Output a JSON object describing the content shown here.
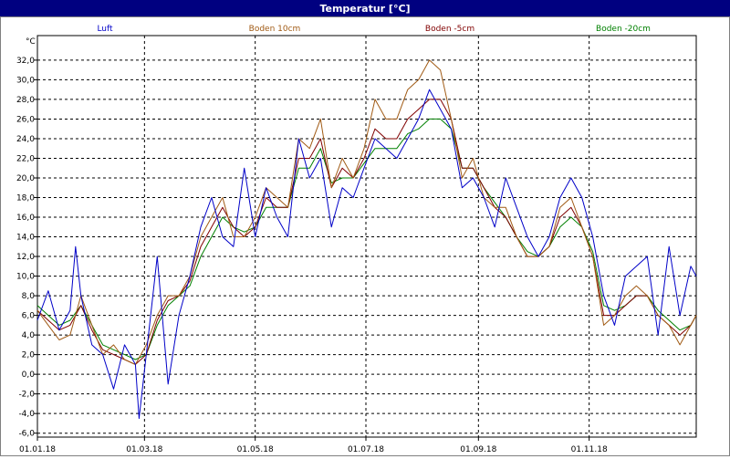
{
  "window": {
    "title": "Temperatur [°C]"
  },
  "colors": {
    "title_bar": "#000080",
    "grid": "#000000",
    "series": {
      "Luft": "#0000c8",
      "Boden 10cm": "#a05a14",
      "Boden -5cm": "#800000",
      "Boden -20cm": "#008000"
    }
  },
  "chart_data": {
    "type": "line",
    "title": "Temperatur [°C]",
    "ylabel": "°C",
    "xlabel": "",
    "x_tick_labels": [
      "01.01.18",
      "01.03.18",
      "01.05.18",
      "01.07.18",
      "01.09.18",
      "01.11.18"
    ],
    "y_tick_labels": [
      "-6,0",
      "-4,0",
      "-2,0",
      "0,0",
      "2,0",
      "4,0",
      "6,0",
      "8,0",
      "10,0",
      "12,0",
      "14,0",
      "16,0",
      "18,0",
      "20,0",
      "22,0",
      "24,0",
      "26,0",
      "28,0",
      "30,0",
      "32,0"
    ],
    "ylim": [
      -6.4,
      34.5
    ],
    "x_range_days": [
      0,
      363
    ],
    "x_tick_days": [
      0,
      59,
      120,
      181,
      243,
      304
    ],
    "grid": true,
    "legend_position": "top",
    "series": [
      {
        "name": "Luft",
        "x": [
          0,
          6,
          12,
          18,
          21,
          24,
          30,
          36,
          42,
          48,
          54,
          56,
          60,
          66,
          72,
          78,
          84,
          90,
          96,
          102,
          108,
          114,
          120,
          126,
          132,
          138,
          144,
          150,
          156,
          162,
          168,
          174,
          180,
          186,
          192,
          198,
          204,
          210,
          216,
          222,
          228,
          234,
          240,
          246,
          252,
          258,
          264,
          270,
          276,
          282,
          288,
          294,
          300,
          306,
          312,
          318,
          324,
          330,
          336,
          342,
          348,
          354,
          360,
          363
        ],
        "y": [
          5.5,
          8.5,
          4.5,
          6.5,
          13,
          8,
          3,
          2,
          -1.5,
          3,
          1,
          -4.5,
          2,
          12,
          -1,
          6,
          10,
          15,
          18,
          14,
          13,
          21,
          14,
          19,
          16,
          14,
          24,
          20,
          22,
          15,
          19,
          18,
          21,
          24,
          23,
          22,
          24,
          26,
          29,
          27,
          25,
          19,
          20,
          18,
          15,
          20,
          17,
          14,
          12,
          14,
          18,
          20,
          18,
          14,
          8,
          5,
          10,
          11,
          12,
          4,
          13,
          6,
          11,
          10
        ]
      },
      {
        "name": "Boden 10cm",
        "x": [
          0,
          6,
          12,
          18,
          24,
          30,
          36,
          42,
          48,
          54,
          60,
          66,
          72,
          78,
          84,
          90,
          96,
          102,
          108,
          114,
          120,
          126,
          132,
          138,
          144,
          150,
          156,
          162,
          168,
          174,
          180,
          186,
          192,
          198,
          204,
          210,
          216,
          222,
          228,
          234,
          240,
          246,
          252,
          258,
          264,
          270,
          276,
          282,
          288,
          294,
          300,
          306,
          312,
          318,
          324,
          330,
          336,
          342,
          348,
          354,
          360,
          363
        ],
        "y": [
          6.5,
          5,
          3.5,
          4,
          8,
          5,
          2,
          3,
          1.5,
          1,
          3,
          6,
          8,
          8,
          10,
          14,
          16,
          18,
          14,
          14,
          16,
          19,
          18,
          17,
          24,
          23,
          26,
          19,
          22,
          20,
          23,
          28,
          26,
          26,
          29,
          30,
          32,
          31,
          26,
          20,
          22,
          18,
          17,
          17,
          14,
          12,
          12,
          13,
          17,
          18,
          15,
          12,
          5,
          6,
          8,
          9,
          8,
          6,
          5,
          3,
          5,
          6
        ]
      },
      {
        "name": "Boden -5cm",
        "x": [
          0,
          6,
          12,
          18,
          24,
          30,
          36,
          42,
          48,
          54,
          60,
          66,
          72,
          78,
          84,
          90,
          96,
          102,
          108,
          114,
          120,
          126,
          132,
          138,
          144,
          150,
          156,
          162,
          168,
          174,
          180,
          186,
          192,
          198,
          204,
          210,
          216,
          222,
          228,
          234,
          240,
          246,
          252,
          258,
          264,
          270,
          276,
          282,
          288,
          294,
          300,
          306,
          312,
          318,
          324,
          330,
          336,
          342,
          348,
          354,
          360,
          363
        ],
        "y": [
          6.5,
          5.5,
          4.5,
          5,
          7,
          4.5,
          2.5,
          2,
          1.5,
          1,
          2,
          5.5,
          7.5,
          8,
          9.5,
          13,
          15,
          17,
          15,
          14,
          15,
          18,
          17,
          17,
          22,
          22,
          24,
          19,
          21,
          20,
          22,
          25,
          24,
          24,
          26,
          27,
          28,
          28,
          26,
          21,
          21,
          19,
          17,
          16,
          14,
          12,
          12,
          13,
          16,
          17,
          15,
          12,
          6,
          6,
          7,
          8,
          8,
          6,
          5,
          4,
          5,
          6
        ]
      },
      {
        "name": "Boden -20cm",
        "x": [
          0,
          6,
          12,
          18,
          24,
          30,
          36,
          42,
          48,
          54,
          60,
          66,
          72,
          78,
          84,
          90,
          96,
          102,
          108,
          114,
          120,
          126,
          132,
          138,
          144,
          150,
          156,
          162,
          168,
          174,
          180,
          186,
          192,
          198,
          204,
          210,
          216,
          222,
          228,
          234,
          240,
          246,
          252,
          258,
          264,
          270,
          276,
          282,
          288,
          294,
          300,
          306,
          312,
          318,
          324,
          330,
          336,
          342,
          348,
          354,
          360,
          363
        ],
        "y": [
          7,
          6,
          5,
          5.5,
          7,
          5,
          3,
          2.5,
          2,
          1.5,
          2,
          5,
          7,
          8,
          9,
          12,
          14,
          16,
          15,
          14.5,
          15,
          17,
          17,
          17,
          21,
          21,
          23,
          19.5,
          20,
          20,
          21.5,
          23,
          23,
          23,
          24.5,
          25,
          26,
          26,
          25,
          21,
          21,
          19,
          17.5,
          16,
          14,
          12.5,
          12,
          13,
          15,
          16,
          15,
          12.5,
          7,
          6.5,
          7,
          8,
          8,
          6.5,
          5.5,
          4.5,
          5,
          6
        ]
      }
    ]
  }
}
